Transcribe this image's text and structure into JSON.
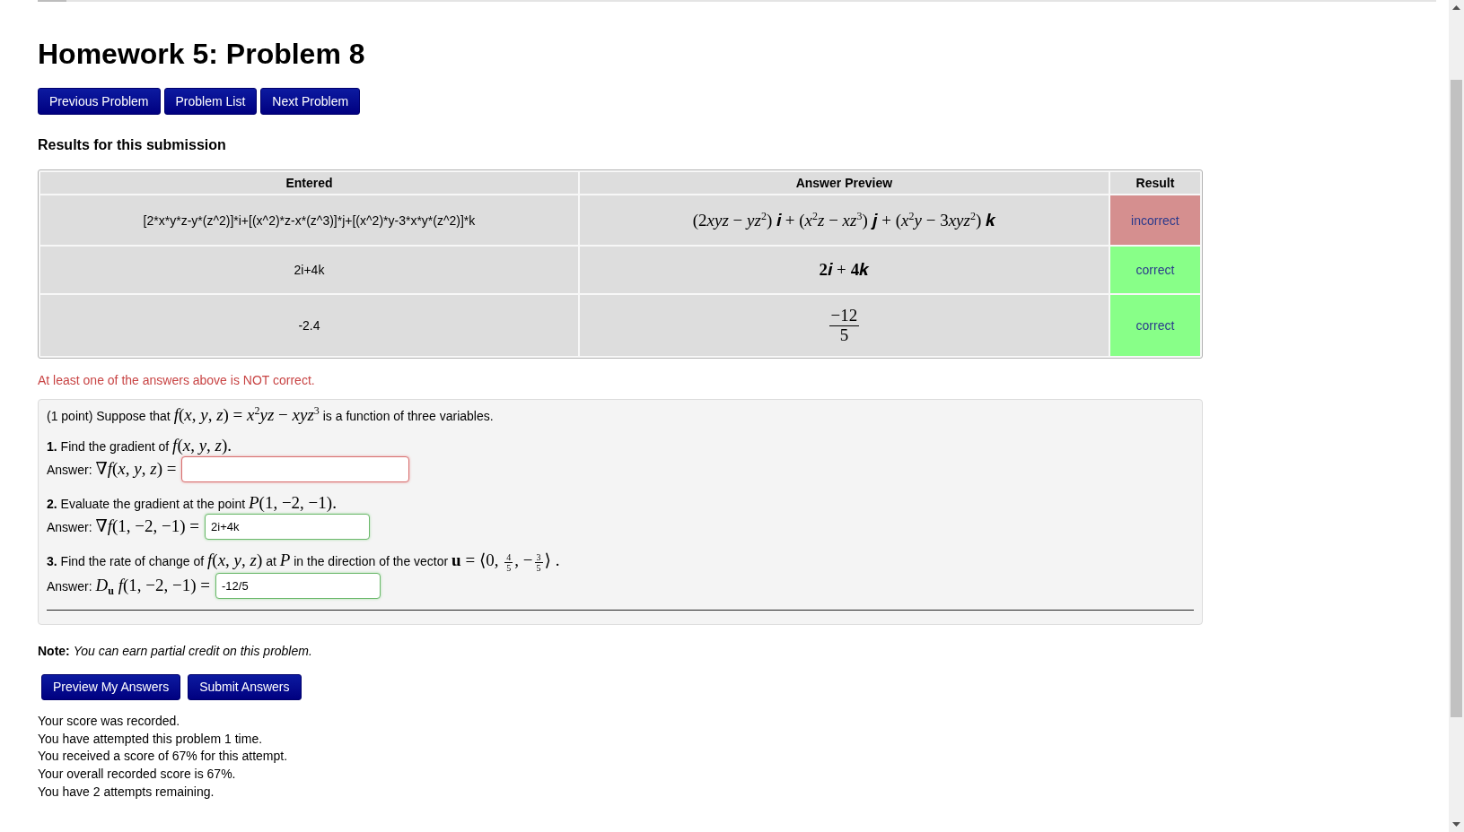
{
  "page_title": "Homework 5: Problem 8",
  "nav_buttons": [
    "Previous Problem",
    "Problem List",
    "Next Problem"
  ],
  "results": {
    "heading": "Results for this submission",
    "columns": [
      "Entered",
      "Answer Preview",
      "Result"
    ],
    "rows": [
      {
        "entered": "[2*x*y*z-y*(z^2)]*i+[(x^2)*z-x*(z^3)]*j+[(x^2)*y-3*x*y*(z^2)]*k",
        "preview": [
          {
            "kind": "math",
            "text": "(2"
          },
          {
            "kind": "math",
            "text": "*xyz* − *yz*$^{2}$) 𝒊 + (*x*$^{2}$*z* − *xz*$^{3}$) 𝒋 + (*x*$^{2}$*y* − 3"
          },
          {
            "kind": "math",
            "text": "*xyz*$^{2}$) 𝒌"
          }
        ],
        "result": "incorrect",
        "correct": false
      },
      {
        "entered": "2i+4k",
        "preview": [
          {
            "kind": "math",
            "text": "**2**𝒊"
          },
          {
            "kind": "op",
            "text": "+"
          },
          {
            "kind": "math",
            "text": "**4**𝒌"
          }
        ],
        "result": "correct",
        "correct": true
      },
      {
        "entered": "-2.4",
        "preview": [
          {
            "kind": "frac",
            "num": "−12",
            "den": "5"
          }
        ],
        "result": "correct",
        "correct": true
      }
    ]
  },
  "message": "At least one of the answers above is NOT correct.",
  "problem": {
    "intro": [
      {
        "kind": "text",
        "text": "(1 point) Suppose that "
      },
      {
        "kind": "math",
        "text": "*f*(*x*, *y*, *z*) = *x*$^{2}$*yz* − *xyz*$^{3}$"
      },
      {
        "kind": "text",
        "text": " is a function of three variables."
      }
    ],
    "questions": [
      {
        "prompt": [
          {
            "kind": "text",
            "text": "**1.** Find the gradient of "
          },
          {
            "kind": "math",
            "text": "*f*(*x*, *y*, *z*)."
          }
        ],
        "answer_label": [
          {
            "kind": "text",
            "text": "Answer: "
          },
          {
            "kind": "math",
            "text": "∇*f*(*x*, *y*, *z*) ="
          }
        ],
        "answer": {
          "correct": false
        }
      },
      {
        "prompt": [
          {
            "kind": "text",
            "text": "**2.** Evaluate the gradient at the point "
          },
          {
            "kind": "math",
            "text": "*P*(1, −2, −1)."
          }
        ],
        "answer_label": [
          {
            "kind": "text",
            "text": "Answer: "
          },
          {
            "kind": "math",
            "text": "∇*f*(1, −2, −1) ="
          }
        ],
        "answer": {
          "value": "2i+4k",
          "correct": true
        }
      },
      {
        "prompt": [
          {
            "kind": "text",
            "text": "**3.** Find the rate of change of "
          },
          {
            "kind": "math",
            "text": "*f*(*x*, *y*, *z*)"
          },
          {
            "kind": "text",
            "text": " at "
          },
          {
            "kind": "math",
            "text": "*P*"
          },
          {
            "kind": "text",
            "text": " in the direction of the vector "
          },
          {
            "kind": "math",
            "text": "**u** = ⟨0, "
          },
          {
            "kind": "frac",
            "num": "4",
            "den": "5"
          },
          {
            "kind": "math",
            "text": ", −"
          },
          {
            "kind": "frac",
            "num": "3",
            "den": "5"
          },
          {
            "kind": "math",
            "text": "⟩ ."
          }
        ],
        "answer_label": [
          {
            "kind": "text",
            "text": "Answer: "
          },
          {
            "kind": "math",
            "text": "*D*"
          },
          {
            "kind": "sub",
            "text": "**u**"
          },
          {
            "kind": "math",
            "text": " *f*(1, −2, −1) ="
          }
        ],
        "answer": {
          "value": "-12/5",
          "correct": true
        }
      }
    ]
  },
  "note": "**Note:** *You can earn partial credit on this problem.*",
  "action_buttons": [
    "Preview My Answers",
    "Submit Answers"
  ],
  "status_lines": [
    "Your score was recorded.",
    "You have attempted this problem 1 time.",
    "You received a score of 67% for this attempt.",
    "Your overall recorded score is 67%.",
    "You have 2 attempts remaining."
  ]
}
